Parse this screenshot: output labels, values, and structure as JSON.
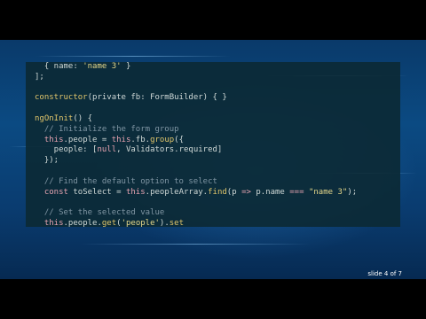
{
  "colors": {
    "background": "#0b4a82",
    "code_panel": "#0c2a36",
    "keyword": "#e6a3b0",
    "function": "#e0c56a",
    "string": "#e6d88a",
    "comment": "#7f95a3",
    "plain": "#cfd8d6"
  },
  "code": {
    "lines": [
      [
        {
          "t": "plain",
          "v": "  { name: "
        },
        {
          "t": "str",
          "v": "'name 3'"
        },
        {
          "t": "plain",
          "v": " }"
        }
      ],
      [
        {
          "t": "plain",
          "v": "];"
        }
      ],
      [
        {
          "t": "plain",
          "v": ""
        }
      ],
      [
        {
          "t": "fn",
          "v": "constructor"
        },
        {
          "t": "plain",
          "v": "(private fb: FormBuilder) { }"
        }
      ],
      [
        {
          "t": "plain",
          "v": ""
        }
      ],
      [
        {
          "t": "fn",
          "v": "ngOnInit"
        },
        {
          "t": "plain",
          "v": "() {"
        }
      ],
      [
        {
          "t": "cm",
          "v": "  // Initialize the form group"
        }
      ],
      [
        {
          "t": "kw",
          "v": "  this"
        },
        {
          "t": "plain",
          "v": ".people = "
        },
        {
          "t": "kw",
          "v": "this"
        },
        {
          "t": "plain",
          "v": ".fb."
        },
        {
          "t": "fn",
          "v": "group"
        },
        {
          "t": "plain",
          "v": "({"
        }
      ],
      [
        {
          "t": "plain",
          "v": "    people: ["
        },
        {
          "t": "kw",
          "v": "null"
        },
        {
          "t": "plain",
          "v": ", Validators.required]"
        }
      ],
      [
        {
          "t": "plain",
          "v": "  });"
        }
      ],
      [
        {
          "t": "plain",
          "v": ""
        }
      ],
      [
        {
          "t": "cm",
          "v": "  // Find the default option to select"
        }
      ],
      [
        {
          "t": "kw",
          "v": "  const"
        },
        {
          "t": "plain",
          "v": " toSelect = "
        },
        {
          "t": "kw",
          "v": "this"
        },
        {
          "t": "plain",
          "v": ".peopleArray."
        },
        {
          "t": "fn",
          "v": "find"
        },
        {
          "t": "plain",
          "v": "(p "
        },
        {
          "t": "kw",
          "v": "=>"
        },
        {
          "t": "plain",
          "v": " p.name "
        },
        {
          "t": "kw",
          "v": "==="
        },
        {
          "t": "plain",
          "v": " "
        },
        {
          "t": "str",
          "v": "\"name 3\""
        },
        {
          "t": "plain",
          "v": ");"
        }
      ],
      [
        {
          "t": "plain",
          "v": ""
        }
      ],
      [
        {
          "t": "cm",
          "v": "  // Set the selected value"
        }
      ],
      [
        {
          "t": "kw",
          "v": "  this"
        },
        {
          "t": "plain",
          "v": ".people."
        },
        {
          "t": "fn",
          "v": "get"
        },
        {
          "t": "plain",
          "v": "("
        },
        {
          "t": "str",
          "v": "'people'"
        },
        {
          "t": "plain",
          "v": ")."
        },
        {
          "t": "fn",
          "v": "set"
        }
      ]
    ]
  },
  "slide_counter": "slide 4 of 7"
}
